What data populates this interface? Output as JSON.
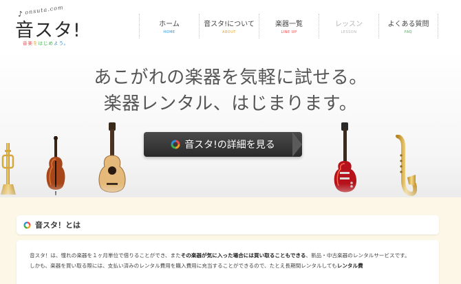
{
  "logo": {
    "roman": "onsuta.com",
    "note": "♪",
    "title": "音スタ!",
    "tagline": [
      "音楽",
      "を",
      "はじめ",
      "よう。"
    ]
  },
  "nav": [
    {
      "label": "ホーム",
      "sub": "HOME",
      "sub_color": "#2c8fd6",
      "enabled": true
    },
    {
      "label": "音スタ!について",
      "sub": "ABOUT",
      "sub_color": "#f0a020",
      "enabled": true
    },
    {
      "label": "楽器一覧",
      "sub": "LINE UP",
      "sub_color": "#e94a4a",
      "enabled": true
    },
    {
      "label": "レッスン",
      "sub": "LESSON",
      "sub_color": "#b5b5b5",
      "enabled": false
    },
    {
      "label": "よくある質問",
      "sub": "FAQ",
      "sub_color": "#3bb14a",
      "enabled": true
    }
  ],
  "hero": {
    "line1": "あこがれの楽器を気軽に試せる。",
    "line2": "楽器レンタル、はじまります。",
    "cta": "音スタ!の詳細を見る"
  },
  "instrument_icons": [
    "trumpet-icon",
    "contrabass-icon",
    "acoustic-guitar-icon",
    "electric-guitar-icon",
    "saxophone-icon"
  ],
  "about": {
    "title": "音スタ！とは",
    "p1_a": "音スタ！は、憧れの楽器を１ヶ月単位で借りることができ、また",
    "p1_b": "その楽器が気に入った場合には買い取ることもできる",
    "p1_c": "、新品・中古楽器のレンタルサービスです。",
    "p2_a": "しかも、楽器を買い取る際には、支払い済みのレンタル費用を購入費用に充当することができるので、たとえ長期間レンタルしても",
    "p2_b": "レンタル費"
  },
  "colors": {
    "ring": [
      "#e94a4a",
      "#f0a020",
      "#3bb14a",
      "#2c8fd6"
    ],
    "content_bg": "#fcf7e6"
  }
}
